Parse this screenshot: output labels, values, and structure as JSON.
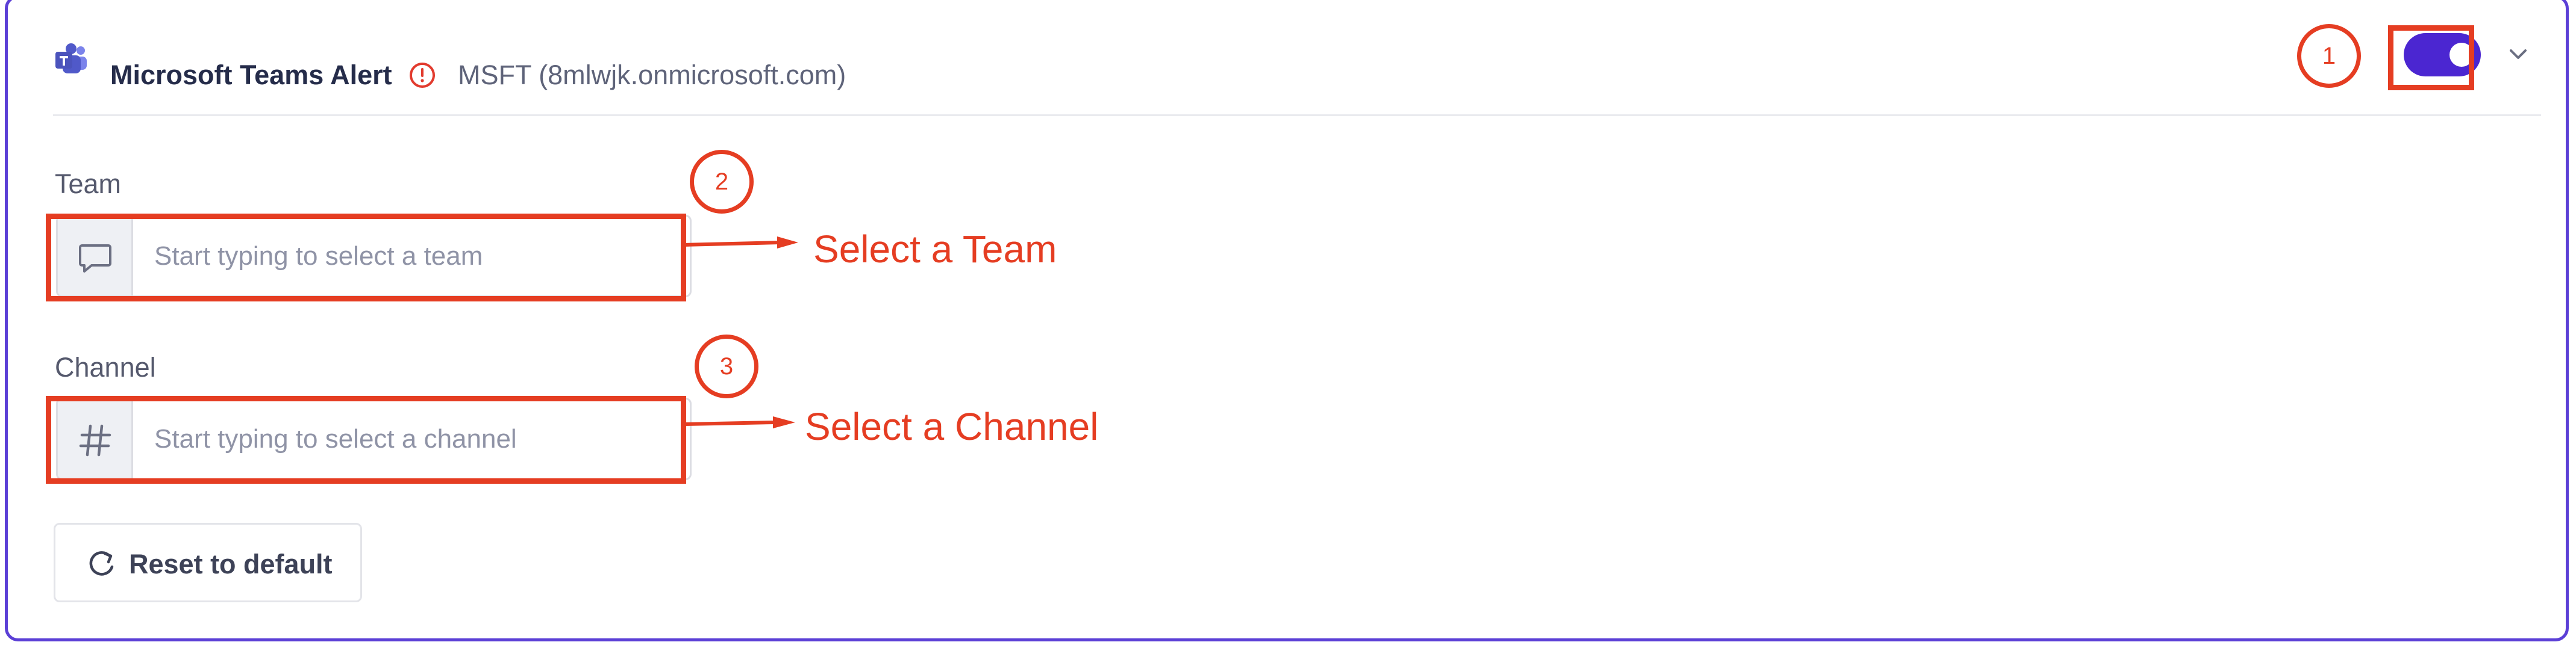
{
  "alert": {
    "title": "Microsoft Teams Alert",
    "account": "MSFT (8mlwjk.onmicrosoft.com)",
    "enabled": true
  },
  "team_field": {
    "label": "Team",
    "placeholder": "Start typing to select a team",
    "icon": "chat-bubble-icon"
  },
  "channel_field": {
    "label": "Channel",
    "placeholder": "Start typing to select a channel",
    "icon": "hash-icon"
  },
  "reset": {
    "label": "Reset to default"
  },
  "annotations": {
    "step1": "1",
    "step2": "2",
    "step3": "3",
    "team_note": "Select a Team",
    "channel_note": "Select a Channel"
  },
  "colors": {
    "accent": "#4b26d1",
    "border": "#5b3fd6",
    "annotation": "#e53d22",
    "warning": "#e23b2e"
  }
}
